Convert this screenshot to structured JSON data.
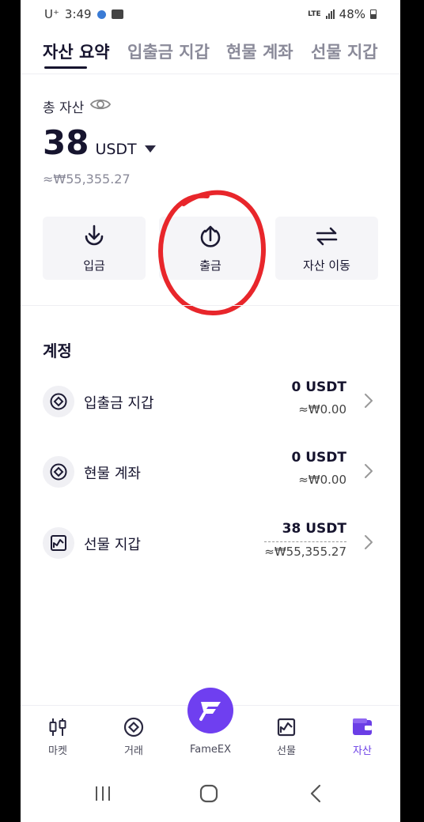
{
  "status": {
    "carrier": "U⁺",
    "time": "3:49",
    "network": "LTE",
    "battery": "48%"
  },
  "tabs": [
    {
      "label": "자산 요약",
      "active": true
    },
    {
      "label": "입출금 지갑",
      "active": false
    },
    {
      "label": "현물 계좌",
      "active": false
    },
    {
      "label": "선물 지갑",
      "active": false
    }
  ],
  "summary": {
    "label": "총 자산",
    "value": "38",
    "unit": "USDT",
    "krw": "≈₩55,355.27"
  },
  "actions": [
    {
      "label": "입금",
      "icon": "download-icon"
    },
    {
      "label": "출금",
      "icon": "upload-icon"
    },
    {
      "label": "자산 이동",
      "icon": "transfer-icon"
    }
  ],
  "accounts_section": {
    "title": "계정",
    "items": [
      {
        "name": "입출금 지갑",
        "usdt": "0 USDT",
        "krw": "≈₩0.00",
        "icon": "diamond-circle-icon"
      },
      {
        "name": "현물 계좌",
        "usdt": "0 USDT",
        "krw": "≈₩0.00",
        "icon": "diamond-circle-icon"
      },
      {
        "name": "선물 지갑",
        "usdt": "38 USDT",
        "krw": "≈₩55,355.27",
        "icon": "chart-icon"
      }
    ]
  },
  "bottom_nav": [
    {
      "label": "마켓",
      "icon": "candlestick-icon"
    },
    {
      "label": "거래",
      "icon": "diamond-circle-icon"
    },
    {
      "label": "FameEX",
      "icon": "fameex-logo-icon"
    },
    {
      "label": "선물",
      "icon": "chart-icon"
    },
    {
      "label": "자산",
      "icon": "wallet-icon",
      "active": true
    }
  ],
  "colors": {
    "accent": "#6f3ff0",
    "text": "#16142e",
    "muted": "#8a8a99",
    "annotation": "#e8262b"
  }
}
